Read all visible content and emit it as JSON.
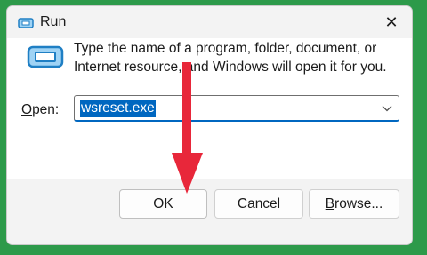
{
  "window": {
    "title": "Run",
    "close_glyph": "✕",
    "app_icon": "run-app-icon"
  },
  "content": {
    "icon": "run-program-icon",
    "description": "Type the name of a program, folder, document, or Internet resource, and Windows will open it for you.",
    "open_label_prefix": "O",
    "open_label_rest": "pen:",
    "command_value": "wsreset.exe",
    "dropdown_icon": "chevron-down-icon"
  },
  "buttons": {
    "ok_label": "OK",
    "cancel_label": "Cancel",
    "browse_label_prefix": "B",
    "browse_label_rest": "rowse..."
  },
  "annotation": {
    "arrow_color": "#e8273a",
    "icon": "red-arrow-pointing-down"
  },
  "colors": {
    "accent": "#0067c0",
    "background": "#2d9a4a"
  }
}
